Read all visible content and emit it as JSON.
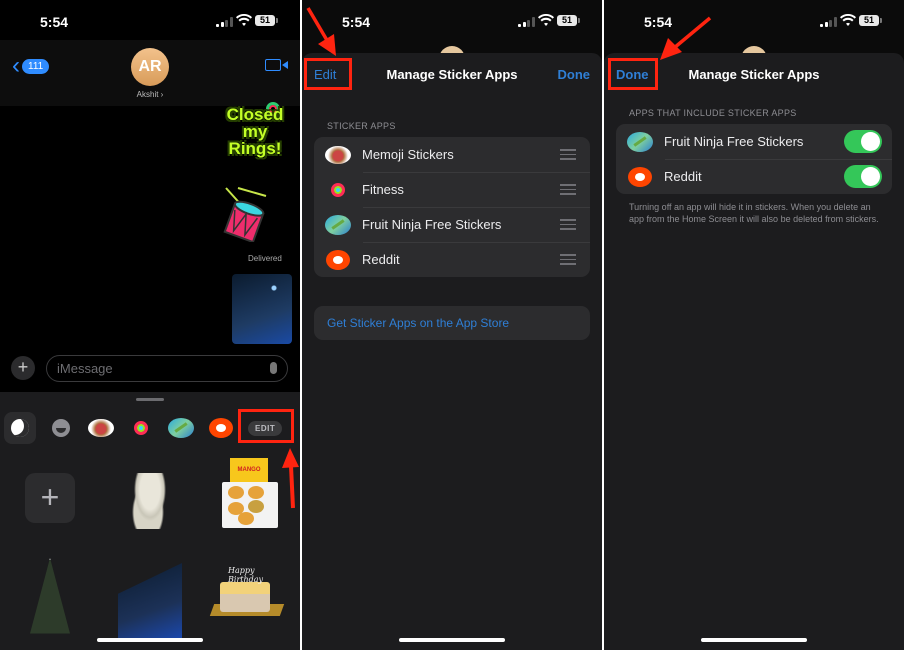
{
  "status_bar": {
    "time": "5:54",
    "battery": "51"
  },
  "panel_messages": {
    "back_badge": "111",
    "avatar_initials": "AR",
    "contact_name": "Akshit ›",
    "sticker_text": [
      "Closed",
      "my",
      "Rings!"
    ],
    "delivered_label": "Delivered",
    "composer": {
      "placeholder": "iMessage"
    },
    "tray": {
      "items": [
        "recents-stickers",
        "emoji",
        "memoji-stickers",
        "fitness",
        "fruit-ninja",
        "reddit"
      ],
      "edit_label": "EDIT"
    },
    "stickers": [
      "add-sticker",
      "monkey",
      "mango-box",
      "christmas-tree",
      "ferris-wheel",
      "birthday-cake"
    ],
    "mango_box_text": "MANGO",
    "cake_text": "Happy Birthday"
  },
  "panel_manage": {
    "nav": {
      "left": "Edit",
      "title": "Manage Sticker Apps",
      "right": "Done"
    },
    "section_title": "STICKER APPS",
    "apps": [
      {
        "name": "Memoji Stickers",
        "icon": "memoji"
      },
      {
        "name": "Fitness",
        "icon": "fitness"
      },
      {
        "name": "Fruit Ninja Free Stickers",
        "icon": "fruit-ninja"
      },
      {
        "name": "Reddit",
        "icon": "reddit"
      }
    ],
    "store_link": "Get Sticker Apps on the App Store"
  },
  "panel_edit": {
    "nav": {
      "left": "Done",
      "title": "Manage Sticker Apps"
    },
    "section_title": "APPS THAT INCLUDE STICKER APPS",
    "apps": [
      {
        "name": "Fruit Ninja Free Stickers",
        "icon": "fruit-ninja",
        "enabled": true
      },
      {
        "name": "Reddit",
        "icon": "reddit",
        "enabled": true
      }
    ],
    "footer": "Turning off an app will hide it in stickers. When you delete an app from the Home Screen it will also be deleted from stickers."
  },
  "colors": {
    "accent": "#2f7fd6",
    "toggle_on": "#34c759",
    "annotation": "#ff2410"
  }
}
